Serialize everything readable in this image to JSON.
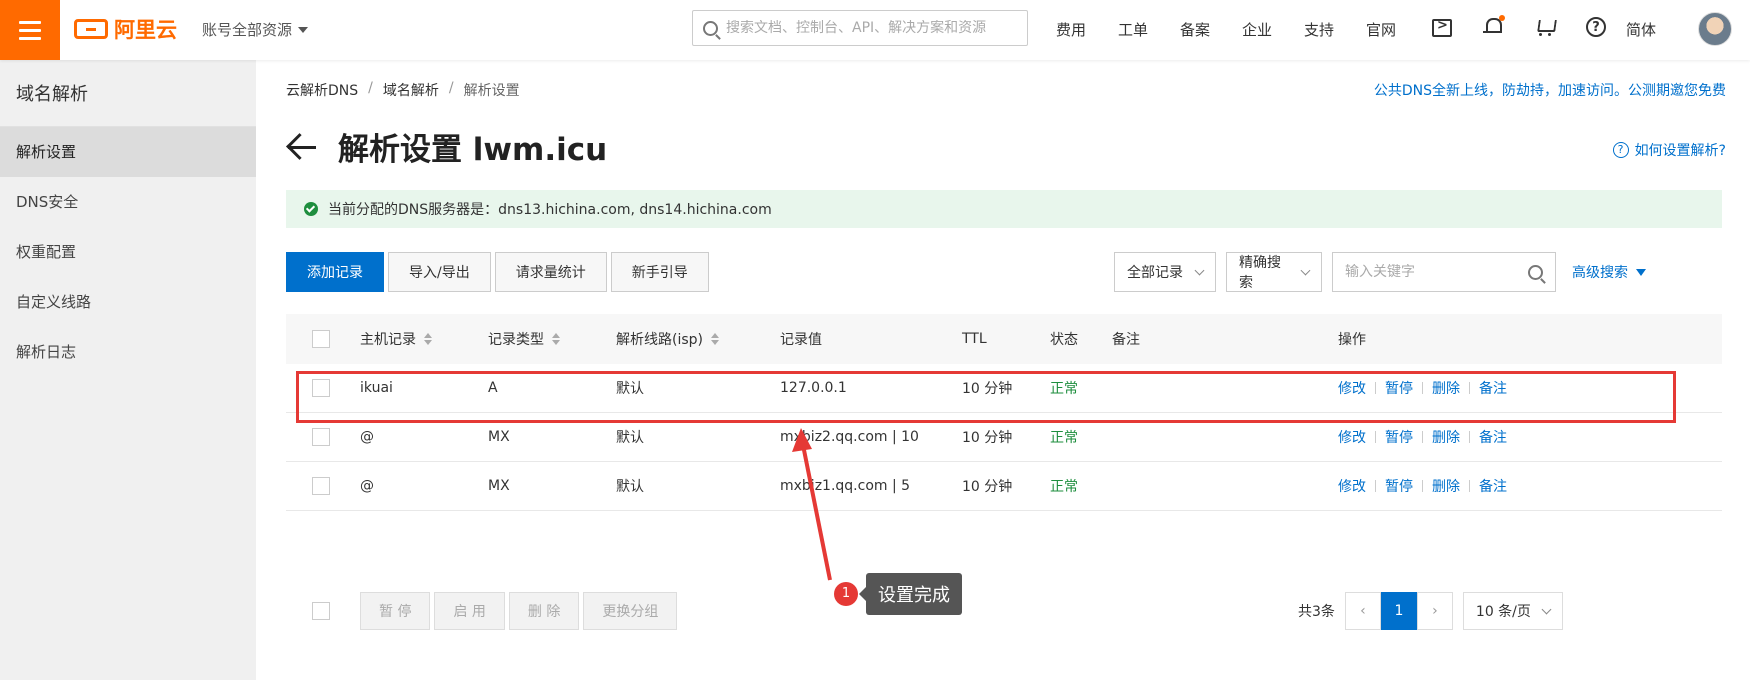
{
  "header": {
    "logo_text": "阿里云",
    "account_label": "账号全部资源",
    "search_placeholder": "搜索文档、控制台、API、解决方案和资源",
    "nav": [
      "费用",
      "工单",
      "备案",
      "企业",
      "支持",
      "官网"
    ],
    "lang": "简体"
  },
  "sidebar": {
    "title": "域名解析",
    "items": [
      {
        "label": "解析设置",
        "active": true
      },
      {
        "label": "DNS安全"
      },
      {
        "label": "权重配置"
      },
      {
        "label": "自定义线路"
      },
      {
        "label": "解析日志"
      }
    ]
  },
  "main": {
    "breadcrumb": [
      "云解析DNS",
      "域名解析",
      "解析设置"
    ],
    "promo": "公共DNS全新上线，防劫持，加速访问。公测期邀您免费",
    "title": "解析设置 lwm.icu",
    "howto": "如何设置解析?",
    "notice": "当前分配的DNS服务器是：dns13.hichina.com, dns14.hichina.com",
    "toolbar": [
      "添加记录",
      "导入/导出",
      "请求量统计",
      "新手引导"
    ],
    "filters": {
      "all_records": "全部记录",
      "exact_search": "精确搜索",
      "keyword_placeholder": "输入关键字",
      "advanced": "高级搜索"
    },
    "table": {
      "headers": [
        "主机记录",
        "记录类型",
        "解析线路(isp)",
        "记录值",
        "TTL",
        "状态",
        "备注",
        "操作"
      ],
      "rows": [
        {
          "host": "ikuai",
          "type": "A",
          "line": "默认",
          "value": "127.0.0.1",
          "ttl": "10 分钟",
          "status": "正常",
          "note": ""
        },
        {
          "host": "@",
          "type": "MX",
          "line": "默认",
          "value": "mxbiz2.qq.com | 10",
          "ttl": "10 分钟",
          "status": "正常",
          "note": ""
        },
        {
          "host": "@",
          "type": "MX",
          "line": "默认",
          "value": "mxbiz1.qq.com | 5",
          "ttl": "10 分钟",
          "status": "正常",
          "note": ""
        }
      ],
      "row_ops": [
        "修改",
        "暂停",
        "删除",
        "备注"
      ]
    },
    "bulk": [
      "暂 停",
      "启 用",
      "删 除",
      "更换分组"
    ],
    "pager": {
      "total": "共3条",
      "current": "1",
      "page_size": "10 条/页"
    }
  },
  "annotation": {
    "badge": "1",
    "text": "设置完成",
    "color": "#e53935"
  },
  "colors": {
    "brand": "#ff6a00",
    "link": "#0070cc",
    "ok": "#1e8e3e"
  }
}
